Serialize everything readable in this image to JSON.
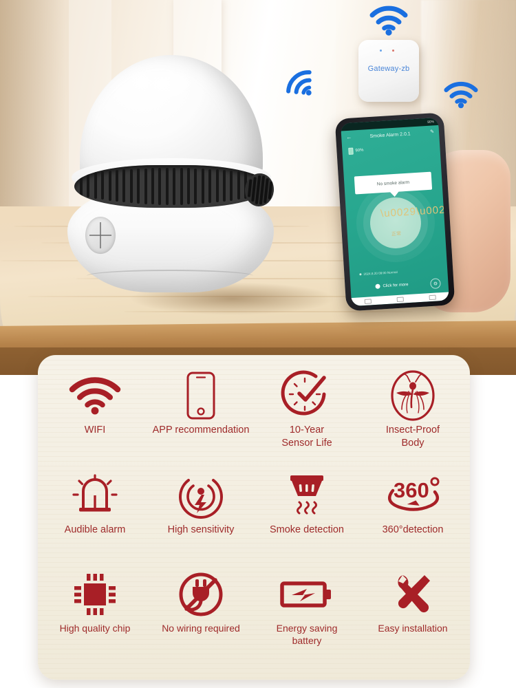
{
  "scene": {
    "gateway": {
      "label": "Gateway-zb",
      "label_color": "#4a86d8"
    },
    "wifi_badges": [
      {
        "name": "wifi-badge-top",
        "color": "#1a6fe0"
      },
      {
        "name": "wifi-badge-left",
        "color": "#1a6fe0"
      },
      {
        "name": "wifi-badge-right",
        "color": "#1a6fe0"
      }
    ],
    "phone": {
      "status_bar_left": "",
      "status_bar_right": "90%",
      "app_title": "Smoke Alarm 2.0.1",
      "back_glyph": "←",
      "edit_glyph": "✎",
      "battery_value": "90%",
      "alert_text": "No smoke alarm",
      "disc_text": "正常",
      "log_text": "2024.8.20 09:00 Normal",
      "cta_label": "Click for more",
      "gear_glyph": "⚙"
    }
  },
  "panel": {
    "accent_color": "#a81f26",
    "label_color": "#9e2a2a",
    "background_color": "#f3eee1",
    "rows": [
      [
        {
          "icon": "wifi-icon",
          "label": "WIFI"
        },
        {
          "icon": "smartphone-icon",
          "label": "APP recommendation"
        },
        {
          "icon": "clock-check-icon",
          "label": "10-Year\nSensor Life"
        },
        {
          "icon": "mosquito-blocked-icon",
          "label": "Insect-Proof\nBody"
        }
      ],
      [
        {
          "icon": "alarm-bell-icon",
          "label": "Audible alarm"
        },
        {
          "icon": "sensitivity-signal-icon",
          "label": "High sensitivity"
        },
        {
          "icon": "smoke-detector-icon",
          "label": "Smoke detection"
        },
        {
          "icon": "360-rotation-icon",
          "label": "360°detection"
        }
      ],
      [
        {
          "icon": "chip-icon",
          "label": "High quality chip"
        },
        {
          "icon": "no-plug-icon",
          "label": "No wiring required"
        },
        {
          "icon": "battery-bolt-icon",
          "label": "Energy saving\nbattery"
        },
        {
          "icon": "tools-icon",
          "label": "Easy installation"
        }
      ]
    ]
  }
}
